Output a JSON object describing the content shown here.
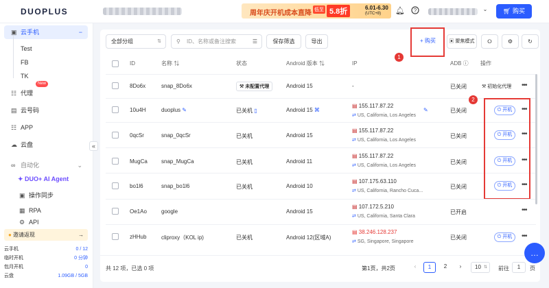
{
  "header": {
    "logo": "DUOPLUS",
    "banner": {
      "title": "周年庆开机成本直降",
      "tag": "低至",
      "discount": "5.8折",
      "dates": "6.01-6.30",
      "tz": "(UTC+8)"
    },
    "buy_label": "购买"
  },
  "sidebar": {
    "cloud_phone": "云手机",
    "subs": [
      "Test",
      "FB",
      "TK"
    ],
    "proxy": "代理",
    "cloud_code": "云号码",
    "new_badge": "New",
    "app": "APP",
    "cloud_disk": "云盘",
    "automation": "自动化",
    "agent": "DUO+ AI Agent",
    "sync": "操作同步",
    "rpa": "RPA",
    "api": "API",
    "invite": "邀请返现",
    "stats": [
      {
        "label": "云手机",
        "value": "0 / 12"
      },
      {
        "label": "临时开机",
        "value": "0 分钟"
      },
      {
        "label": "包月开机",
        "value": "0"
      },
      {
        "label": "云盘",
        "value": "1.09GB / 5GB"
      }
    ]
  },
  "toolbar": {
    "group_select": "全部分组",
    "search_placeholder": "ID、名称或备注搜索",
    "save_filter": "保存筛选",
    "export": "导出",
    "buy": "购买",
    "focus_mode": "聚焦模式"
  },
  "annotations": {
    "c1": "1",
    "c2": "2"
  },
  "table": {
    "columns": {
      "id": "ID",
      "name": "名称",
      "status": "状态",
      "android": "Android 版本",
      "ip": "IP",
      "adb": "ADB",
      "ops": "操作"
    },
    "rows": [
      {
        "id": "8Do6x",
        "name": "snap_8Do6x",
        "status": "未配置代理",
        "android": "Android 15",
        "ip": "-",
        "loc": "",
        "adb": "已关闭",
        "action": "初始化代理"
      },
      {
        "id": "10u4H",
        "name": "duoplus",
        "status": "已关机",
        "android": "Android 15",
        "ip": "155.117.87.22",
        "loc": "US, California, Los Angeles",
        "adb": "已关闭",
        "action": "开机"
      },
      {
        "id": "0qcSr",
        "name": "snap_0qcSr",
        "status": "已关机",
        "android": "Android 15",
        "ip": "155.117.87.22",
        "loc": "US, California, Los Angeles",
        "adb": "已关闭",
        "action": "开机"
      },
      {
        "id": "MugCa",
        "name": "snap_MugCa",
        "status": "已关机",
        "android": "Android 11",
        "ip": "155.117.87.22",
        "loc": "US, California, Los Angeles",
        "adb": "已关闭",
        "action": "开机"
      },
      {
        "id": "bo1l6",
        "name": "snap_bo1l6",
        "status": "已关机",
        "android": "Android 10",
        "ip": "107.175.63.110",
        "loc": "US, California, Rancho Cuca...",
        "adb": "已关闭",
        "action": "开机"
      },
      {
        "id": "Oe1Ao",
        "name": "google",
        "status": "",
        "android": "Android 15",
        "ip": "107.172.5.210",
        "loc": "US, California, Santa Clara",
        "adb": "已开启",
        "action": ""
      },
      {
        "id": "zHHub",
        "name": "cliproxy（KOL ip)",
        "status": "已关机",
        "android": "Android 12(区域A)",
        "ip": "38.246.128.237",
        "loc": "SG, Singapore, Singapore",
        "adb": "已关闭",
        "action": "开机"
      }
    ]
  },
  "footer": {
    "summary": "共 12 项，已选 0 项",
    "page_info": "第1页，共2页",
    "pages": [
      "1",
      "2"
    ],
    "page_size": "10",
    "goto": "前往",
    "goto_value": "1",
    "page_unit": "页"
  }
}
